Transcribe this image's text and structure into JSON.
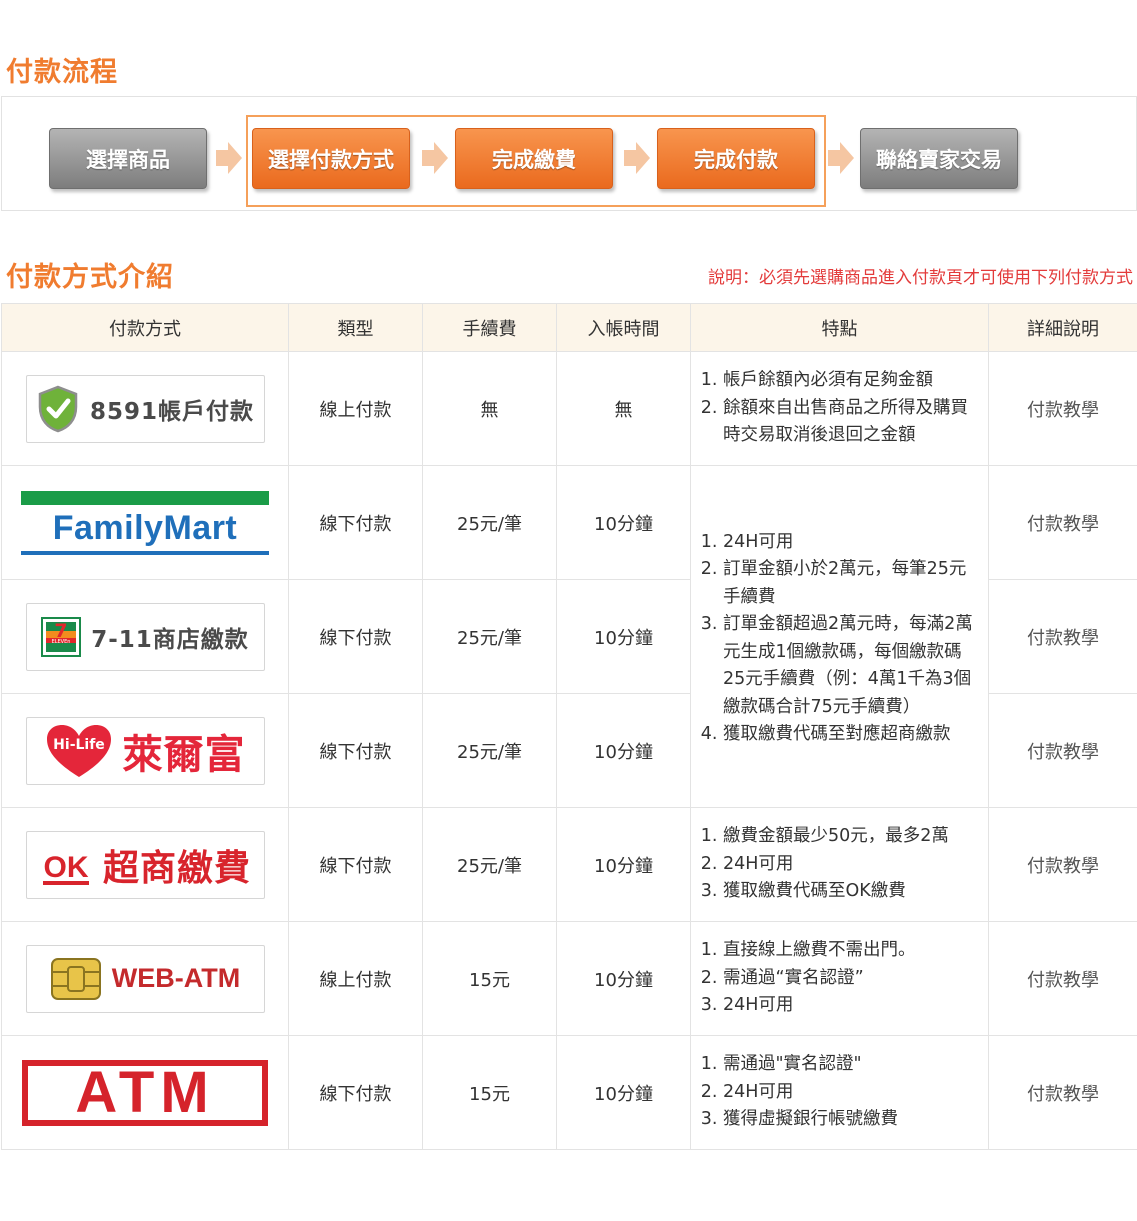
{
  "flow": {
    "title": "付款流程",
    "steps": [
      "選擇商品",
      "選擇付款方式",
      "完成繳費",
      "完成付款",
      "聯絡賣家交易"
    ]
  },
  "methods": {
    "title": "付款方式介紹",
    "note": "說明：必須先選購商品進入付款頁才可使用下列付款方式",
    "headers": [
      "付款方式",
      "類型",
      "手續費",
      "入帳時間",
      "特點",
      "詳細說明"
    ],
    "rows": [
      {
        "logo_text": "8591帳戶付款",
        "type": "線上付款",
        "fee": "無",
        "time": "無",
        "link": "付款教學",
        "features": [
          "帳戶餘額內必須有足夠金額",
          "餘額來自出售商品之所得及購買時交易取消後退回之金額"
        ]
      },
      {
        "logo_text": "FamilyMart",
        "type": "線下付款",
        "fee": "25元/筆",
        "time": "10分鐘",
        "link": "付款教學"
      },
      {
        "logo_text": "7-11商店繳款",
        "type": "線下付款",
        "fee": "25元/筆",
        "time": "10分鐘",
        "link": "付款教學"
      },
      {
        "logo_text": "萊爾富",
        "type": "線下付款",
        "fee": "25元/筆",
        "time": "10分鐘",
        "link": "付款教學"
      },
      {
        "logo_text": "超商繳費",
        "type": "線下付款",
        "fee": "25元/筆",
        "time": "10分鐘",
        "link": "付款教學",
        "features": [
          "繳費金額最少50元，最多2萬",
          "24H可用",
          "獲取繳費代碼至OK繳費"
        ]
      },
      {
        "logo_text": "WEB-ATM",
        "type": "線上付款",
        "fee": "15元",
        "time": "10分鐘",
        "link": "付款教學",
        "features": [
          "直接線上繳費不需出門。",
          "需通過“實名認證”",
          "24H可用"
        ]
      },
      {
        "logo_text": "ATM",
        "type": "線下付款",
        "fee": "15元",
        "time": "10分鐘",
        "link": "付款教學",
        "features": [
          "需通過\"實名認證\"",
          "24H可用",
          "獲得虛擬銀行帳號繳費"
        ]
      }
    ],
    "shared_features": [
      "24H可用",
      "訂單金額小於2萬元，每筆25元手續費",
      "訂單金額超過2萬元時，每滿2萬元生成1個繳款碼，每個繳款碼25元手續費（例：4萬1千為3個繳款碼合計75元手續費）",
      "獲取繳費代碼至對應超商繳款"
    ]
  },
  "logo_badges": {
    "hilife": "Hi-Life",
    "seven": "7",
    "seven_sub": "ELEVEn",
    "ok": "OK"
  },
  "colors": {
    "accent": "#f07c2f",
    "note": "#e33b3b",
    "header_bg": "#fcf5e9"
  }
}
